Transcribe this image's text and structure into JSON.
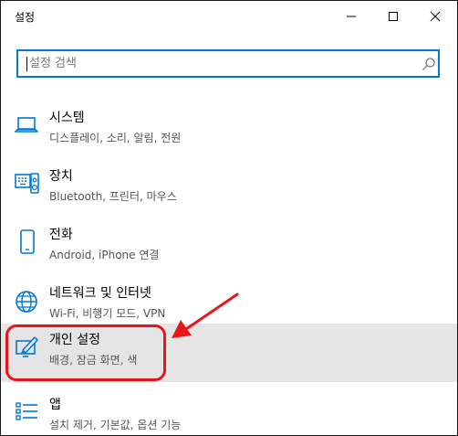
{
  "window": {
    "title": "설정"
  },
  "search": {
    "placeholder": "설정 검색",
    "value": ""
  },
  "items": [
    {
      "title": "시스템",
      "subtitle": "디스플레이, 소리, 알림, 전원",
      "icon": "laptop-icon"
    },
    {
      "title": "장치",
      "subtitle": "Bluetooth, 프린터, 마우스",
      "icon": "devices-icon"
    },
    {
      "title": "전화",
      "subtitle": "Android, iPhone 연결",
      "icon": "phone-icon"
    },
    {
      "title": "네트워크 및 인터넷",
      "subtitle": "Wi-Fi, 비행기 모드, VPN",
      "icon": "globe-icon"
    },
    {
      "title": "개인 설정",
      "subtitle": "배경, 잠금 화면, 색",
      "icon": "personalization-icon",
      "selected": true
    },
    {
      "title": "앱",
      "subtitle": "설치 제거, 기본값, 옵션 기능",
      "icon": "apps-icon"
    }
  ],
  "colors": {
    "accent": "#0078d7",
    "selected_bg": "#e5e5e5",
    "annotation": "#e8151b"
  }
}
